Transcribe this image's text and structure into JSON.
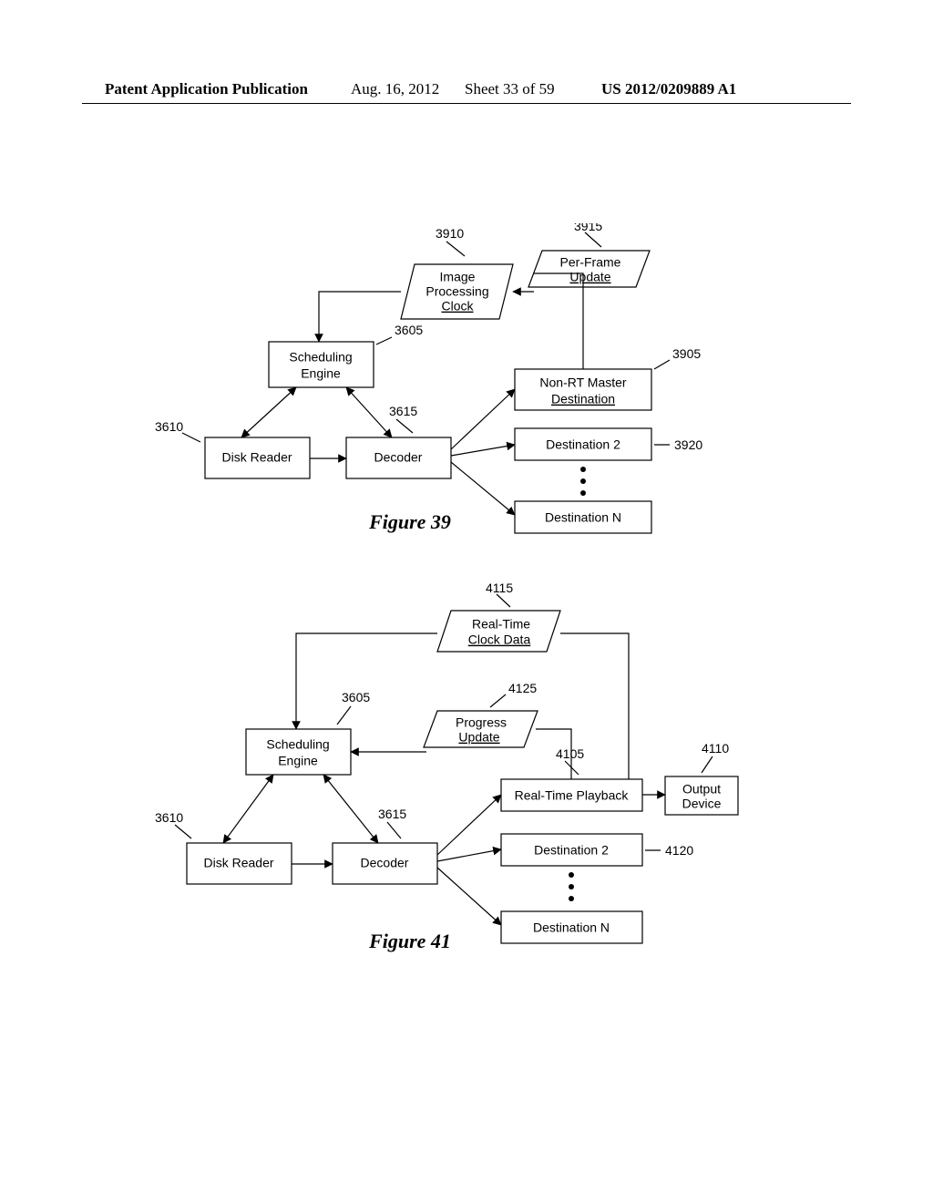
{
  "header": {
    "publication": "Patent Application Publication",
    "date": "Aug. 16, 2012",
    "sheet": "Sheet 33 of 59",
    "code": "US 2012/0209889 A1"
  },
  "fig39": {
    "caption": "Figure 39",
    "boxes": {
      "imgProc1": "Image",
      "imgProc2": "Processing",
      "imgProc3": "Clock",
      "perFrame1": "Per-Frame",
      "perFrame2": "Update",
      "sched1": "Scheduling",
      "sched2": "Engine",
      "diskReader": "Disk Reader",
      "decoder": "Decoder",
      "nonRT1": "Non-RT Master",
      "nonRT2": "Destination",
      "dest2": "Destination 2",
      "destN": "Destination N"
    },
    "refs": {
      "r3910": "3910",
      "r3915": "3915",
      "r3605": "3605",
      "r3905": "3905",
      "r3610": "3610",
      "r3615": "3615",
      "r3920": "3920"
    }
  },
  "fig41": {
    "caption": "Figure 41",
    "boxes": {
      "rtClock1": "Real-Time",
      "rtClock2": "Clock Data",
      "progress1": "Progress",
      "progress2": "Update",
      "sched1": "Scheduling",
      "sched2": "Engine",
      "diskReader": "Disk Reader",
      "decoder": "Decoder",
      "rtPlayback": "Real-Time Playback",
      "output1": "Output",
      "output2": "Device",
      "dest2": "Destination 2",
      "destN": "Destination N"
    },
    "refs": {
      "r4115": "4115",
      "r3605": "3605",
      "r4125": "4125",
      "r4105": "4105",
      "r4110": "4110",
      "r3610": "3610",
      "r3615": "3615",
      "r4120": "4120"
    }
  }
}
